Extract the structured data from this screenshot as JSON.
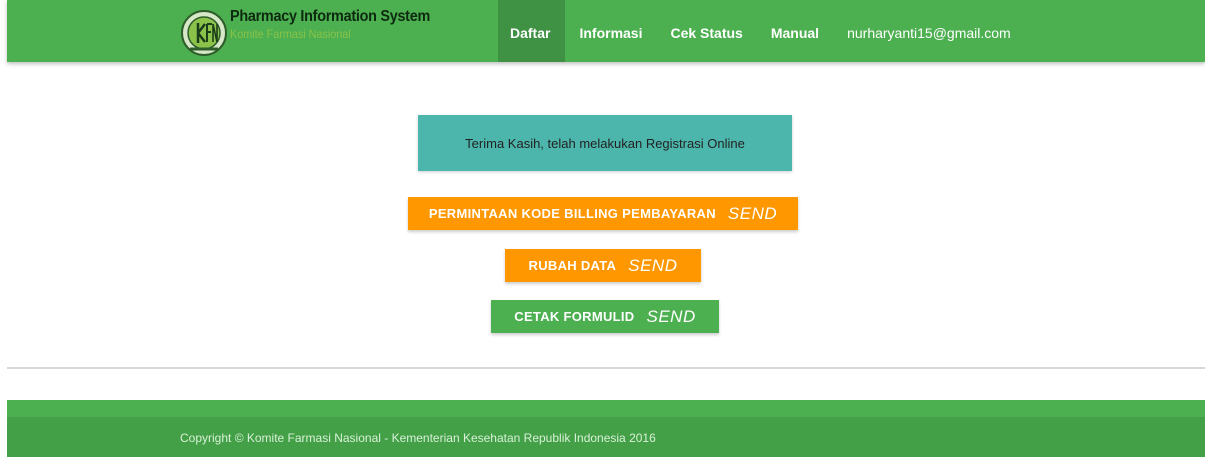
{
  "header": {
    "brand_title": "Pharmacy Information System",
    "brand_subtitle": "Komite Farmasi Nasional",
    "nav": [
      {
        "label": "Daftar"
      },
      {
        "label": "Informasi"
      },
      {
        "label": "Cek Status"
      },
      {
        "label": "Manual"
      },
      {
        "label": "nurharyanti15@gmail.com"
      }
    ]
  },
  "main": {
    "alert_text": "Terima Kasih, telah melakukan Registrasi Online",
    "buttons": [
      {
        "label": "PERMINTAAN KODE BILLING PEMBAYARAN",
        "suffix": "SEND"
      },
      {
        "label": "RUBAH DATA",
        "suffix": "SEND"
      },
      {
        "label": "CETAK FORMULID",
        "suffix": "SEND"
      }
    ]
  },
  "footer": {
    "copyright": "Copyright © Komite Farmasi Nasional - Kementerian Kesehatan Republik Indonesia 2016"
  },
  "colors": {
    "primary_green": "#4caf50",
    "active_green": "#3f9143",
    "alert_teal": "#4db6ac",
    "button_orange": "#ff9800"
  },
  "icons": {
    "logo": "kfn-logo-icon"
  }
}
